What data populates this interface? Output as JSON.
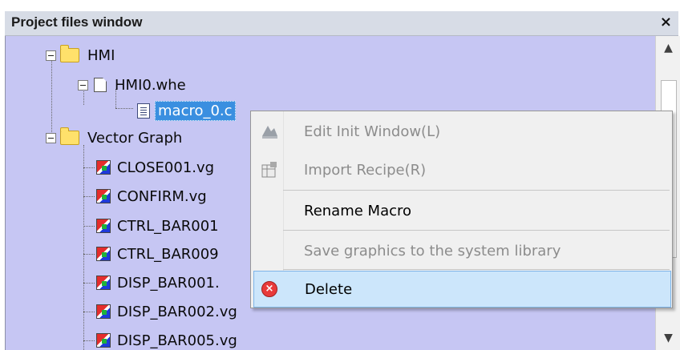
{
  "window": {
    "title": "Project files window",
    "close_glyph": "×"
  },
  "tree": {
    "hmi_folder": "HMI",
    "hmi_file": "HMI0.whe",
    "macro_file": "macro_0.c",
    "vector_folder": "Vector Graph",
    "vector_items": [
      "CLOSE001.vg",
      "CONFIRM.vg",
      "CTRL_BAR001",
      "CTRL_BAR009",
      "DISP_BAR001.",
      "DISP_BAR002.vg",
      "DISP_BAR005.vg"
    ]
  },
  "context_menu": {
    "items": [
      {
        "label": "Edit Init Window(L)",
        "enabled": false,
        "icon": "edit-window-icon"
      },
      {
        "label": "Import Recipe(R)",
        "enabled": false,
        "icon": "import-recipe-icon"
      },
      {
        "label": "Rename Macro",
        "enabled": true,
        "icon": ""
      },
      {
        "label": "Save graphics to the system library",
        "enabled": false,
        "icon": ""
      },
      {
        "label": "Delete",
        "enabled": true,
        "icon": "delete-icon",
        "highlighted": true
      }
    ]
  },
  "colors": {
    "tree_bg": "#c6c6f3",
    "selection": "#3a8fe0",
    "menu_highlight": "#cce6fb"
  }
}
